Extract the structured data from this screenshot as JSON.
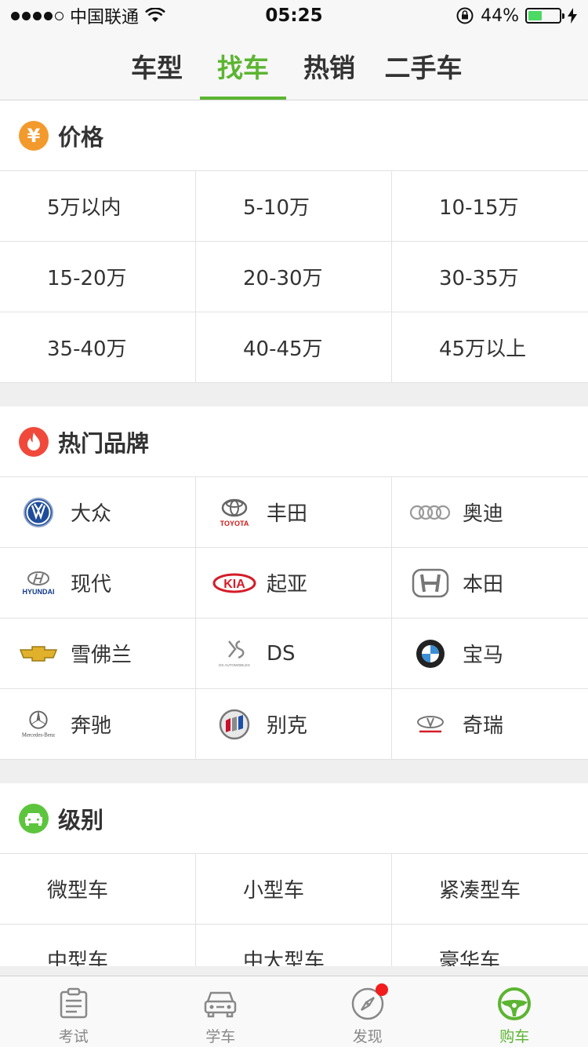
{
  "status_bar": {
    "carrier": "中国联通",
    "time": "05:25",
    "battery": "44%",
    "battery_level": 0.44
  },
  "top_tabs": [
    {
      "label": "车型",
      "active": false
    },
    {
      "label": "找车",
      "active": true
    },
    {
      "label": "热销",
      "active": false
    },
    {
      "label": "二手车",
      "active": false
    }
  ],
  "price_section": {
    "title": "价格",
    "icon_glyph": "¥",
    "icon_color": "#f39a2d",
    "items": [
      "5万以内",
      "5-10万",
      "10-15万",
      "15-20万",
      "20-30万",
      "30-35万",
      "35-40万",
      "40-45万",
      "45万以上"
    ]
  },
  "brand_section": {
    "title": "热门品牌",
    "icon_color": "#f0493b",
    "items": [
      {
        "name": "大众",
        "logo": "volkswagen-logo"
      },
      {
        "name": "丰田",
        "logo": "toyota-logo",
        "logo_text": "TOYOTA"
      },
      {
        "name": "奥迪",
        "logo": "audi-logo"
      },
      {
        "name": "现代",
        "logo": "hyundai-logo",
        "logo_text": "HYUNDAI"
      },
      {
        "name": "起亚",
        "logo": "kia-logo",
        "logo_text": "KIA"
      },
      {
        "name": "本田",
        "logo": "honda-logo"
      },
      {
        "name": "雪佛兰",
        "logo": "chevrolet-logo"
      },
      {
        "name": "DS",
        "logo": "ds-logo",
        "logo_text": "DS AUTOMOBILES"
      },
      {
        "name": "宝马",
        "logo": "bmw-logo"
      },
      {
        "name": "奔驰",
        "logo": "mercedes-logo",
        "logo_text": "Mercedes-Benz"
      },
      {
        "name": "别克",
        "logo": "buick-logo"
      },
      {
        "name": "奇瑞",
        "logo": "chery-logo"
      }
    ]
  },
  "class_section": {
    "title": "级别",
    "icon_color": "#5cc53d",
    "items": [
      "微型车",
      "小型车",
      "紧凑型车",
      "中型车",
      "中大型车",
      "豪华车"
    ]
  },
  "bottom_nav": [
    {
      "label": "考试",
      "icon": "exam-icon",
      "active": false
    },
    {
      "label": "学车",
      "icon": "car-front-icon",
      "active": false
    },
    {
      "label": "发现",
      "icon": "compass-icon",
      "active": false,
      "badge": true
    },
    {
      "label": "购车",
      "icon": "steering-wheel-icon",
      "active": true
    }
  ],
  "colors": {
    "accent": "#5cb531",
    "badge": "#f21c1c"
  }
}
